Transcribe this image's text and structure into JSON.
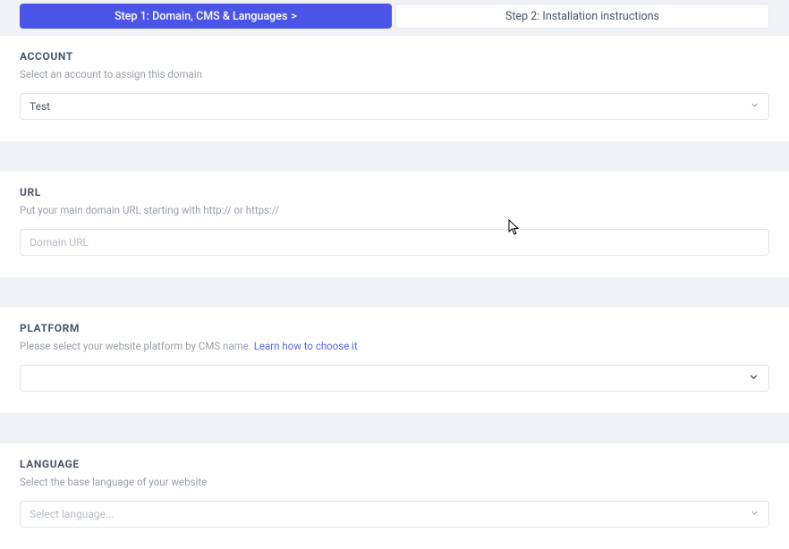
{
  "tabs": {
    "step1": "Step 1: Domain, CMS & Languages",
    "step1_caret": ">",
    "step2": "Step 2: Installation instructions"
  },
  "account": {
    "title": "ACCOUNT",
    "hint": "Select an account to assign this domain",
    "selected": "Test"
  },
  "url": {
    "title": "URL",
    "hint": "Put your main domain URL starting with http:// or https://",
    "placeholder": "Domain URL"
  },
  "platform": {
    "title": "PLATFORM",
    "hint_prefix": "Please select your website platform by CMS name.  ",
    "link": "Learn how to choose it",
    "selected": ""
  },
  "language": {
    "title": "LANGUAGE",
    "hint": "Select the base language of your website",
    "placeholder": "Select language..."
  }
}
